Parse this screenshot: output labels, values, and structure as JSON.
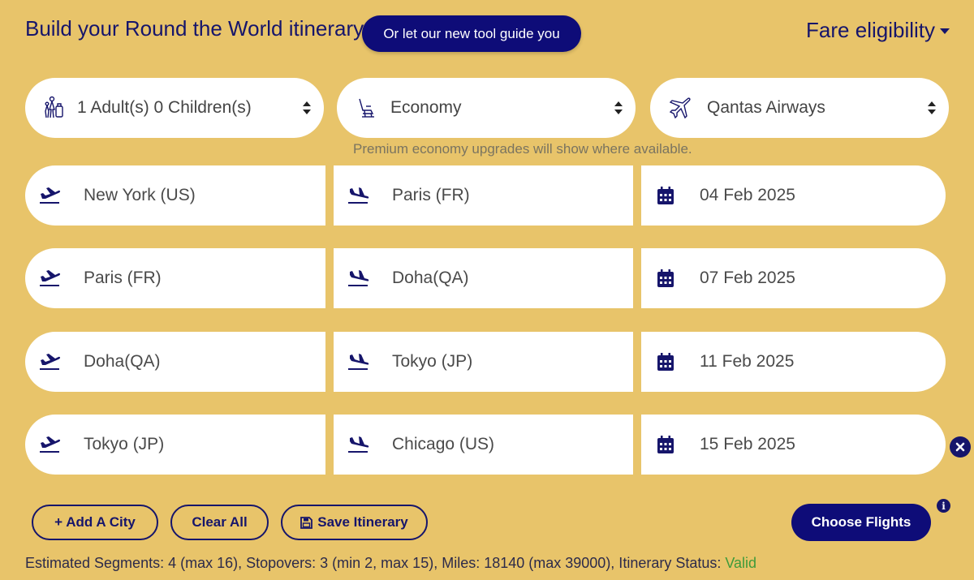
{
  "header": {
    "title": "Build your Round the World itinerary",
    "guide_button": "Or let our new tool guide you",
    "fare_eligibility": "Fare eligibility"
  },
  "selectors": {
    "passengers": "1 Adult(s)  0 Children(s)",
    "cabin": "Economy",
    "airline": "Qantas Airways"
  },
  "note": "Premium economy upgrades will show where available.",
  "segments": [
    {
      "from": "New York (US)",
      "to": "Paris (FR)",
      "date": "04 Feb 2025"
    },
    {
      "from": "Paris (FR)",
      "to": "Doha(QA)",
      "date": "07 Feb 2025"
    },
    {
      "from": "Doha(QA)",
      "to": "Tokyo (JP)",
      "date": "11 Feb 2025"
    },
    {
      "from": "Tokyo (JP)",
      "to": "Chicago (US)",
      "date": "15 Feb 2025"
    }
  ],
  "actions": {
    "add_city": "+ Add A City",
    "clear_all": "Clear All",
    "save_itinerary": "Save Itinerary",
    "choose_flights": "Choose Flights",
    "info": "i"
  },
  "status": {
    "prefix": "Estimated Segments: 4 (max 16), Stopovers: 3 (min 2, max 15), Miles: 18140 (max 39000), Itinerary Status: ",
    "value": "Valid"
  },
  "colors": {
    "background": "#e8c46a",
    "primary": "#0e0c78",
    "valid": "#3f9b3a"
  }
}
